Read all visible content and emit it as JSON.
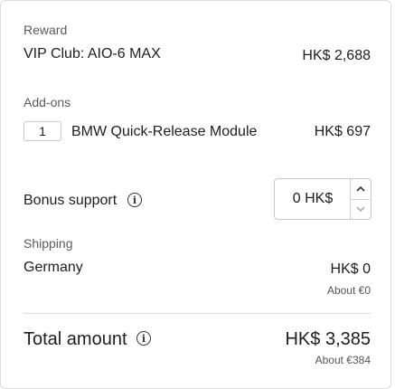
{
  "reward": {
    "section_label": "Reward",
    "name": "VIP Club: AIO-6 MAX",
    "price": "HK$ 2,688"
  },
  "addons": {
    "section_label": "Add-ons",
    "items": [
      {
        "quantity": "1",
        "name": "BMW Quick-Release Module",
        "price": "HK$ 697"
      }
    ]
  },
  "bonus": {
    "label": "Bonus support",
    "value": "0 HK$",
    "icons": {
      "info": "info-icon",
      "increment": "chevron-up-icon",
      "decrement": "chevron-down-icon"
    }
  },
  "shipping": {
    "section_label": "Shipping",
    "destination": "Germany",
    "price": "HK$ 0",
    "approx": "About €0"
  },
  "total": {
    "label": "Total amount",
    "price": "HK$ 3,385",
    "approx": "About €384"
  }
}
